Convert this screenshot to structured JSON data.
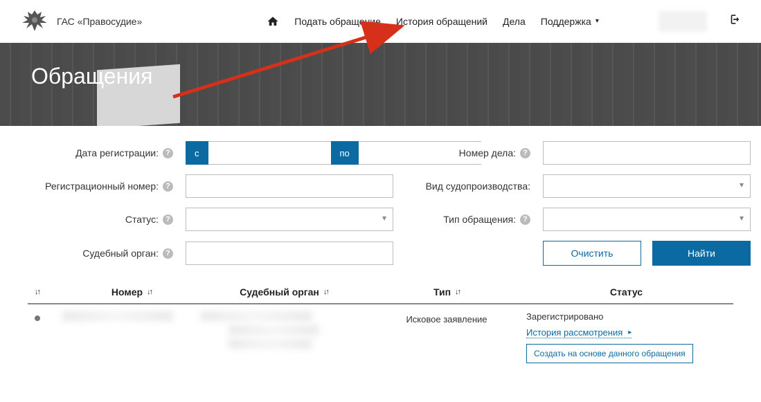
{
  "brand": "ГАС «Правосудие»",
  "nav": {
    "submit": "Подать обращение",
    "history": "История обращений",
    "cases": "Дела",
    "support": "Поддержка"
  },
  "banner": {
    "title": "Обращения"
  },
  "filters": {
    "reg_date_label": "Дата регистрации:",
    "reg_date_from_chip": "с",
    "reg_date_to_chip": "по",
    "reg_number_label": "Регистрационный номер:",
    "status_label": "Статус:",
    "court_label": "Судебный орган:",
    "case_number_label": "Номер дела:",
    "proceeding_type_label": "Вид судопроизводства:",
    "appeal_type_label": "Тип обращения:",
    "clear": "Очистить",
    "find": "Найти"
  },
  "table": {
    "head": {
      "number": "Номер",
      "court": "Судебный орган",
      "type": "Тип",
      "status": "Статус"
    },
    "rows": [
      {
        "type": "Исковое заявление",
        "status": "Зарегистрировано",
        "history_link": "История рассмотрения",
        "create_from": "Создать на основе данного обращения"
      }
    ]
  }
}
